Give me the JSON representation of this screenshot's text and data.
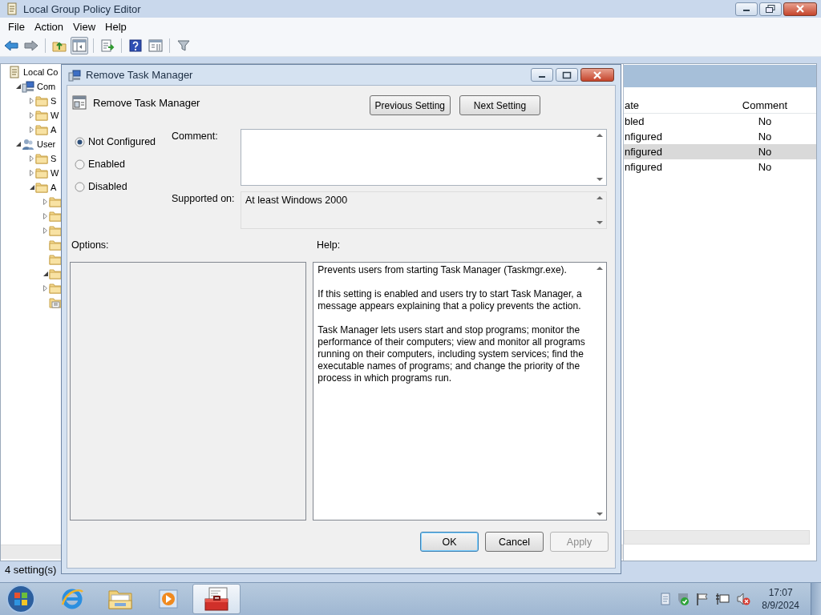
{
  "main_window": {
    "title": "Local Group Policy Editor",
    "menu": [
      "File",
      "Action",
      "View",
      "Help"
    ],
    "toolbar": [
      {
        "kind": "button",
        "pressed": false
      },
      {
        "kind": "button",
        "pressed": false
      },
      {
        "kind": "separator"
      },
      {
        "kind": "button",
        "pressed": false
      },
      {
        "kind": "button",
        "pressed": true
      },
      {
        "kind": "separator"
      },
      {
        "kind": "button",
        "pressed": false
      },
      {
        "kind": "separator"
      },
      {
        "kind": "button",
        "pressed": false
      },
      {
        "kind": "button",
        "pressed": false
      },
      {
        "kind": "separator"
      },
      {
        "kind": "button",
        "pressed": false
      }
    ],
    "tree": [
      {
        "label": "Local Co",
        "kind": "policy",
        "children": [
          {
            "label": "Com",
            "kind": "computer",
            "expanded": true,
            "children": [
              {
                "label": "S",
                "kind": "folder",
                "expanded": false
              },
              {
                "label": "W",
                "kind": "folder",
                "expanded": false
              },
              {
                "label": "A",
                "kind": "folder",
                "expanded": false
              }
            ]
          },
          {
            "label": "User",
            "kind": "user",
            "expanded": true,
            "children": [
              {
                "label": "S",
                "kind": "folder",
                "expanded": false
              },
              {
                "label": "W",
                "kind": "folder",
                "expanded": false
              },
              {
                "label": "A",
                "kind": "folder",
                "expanded": true,
                "children": [
                  {
                    "kind": "folder",
                    "expanded": false
                  },
                  {
                    "kind": "folder",
                    "expanded": false
                  },
                  {
                    "kind": "folder",
                    "expanded": false
                  },
                  {
                    "kind": "folder"
                  },
                  {
                    "kind": "folder"
                  },
                  {
                    "kind": "folder",
                    "expanded": true
                  },
                  {
                    "kind": "folder",
                    "expanded": false
                  },
                  {
                    "kind": "settings"
                  }
                ]
              }
            ]
          }
        ]
      }
    ],
    "list": {
      "columns": [
        "ate",
        "Comment"
      ],
      "rows": [
        {
          "cells": [
            "bled",
            "No"
          ],
          "selected": false
        },
        {
          "cells": [
            "nfigured",
            "No"
          ],
          "selected": false
        },
        {
          "cells": [
            "nfigured",
            "No"
          ],
          "selected": true
        },
        {
          "cells": [
            "nfigured",
            "No"
          ],
          "selected": false
        }
      ]
    },
    "status_bar": "4 setting(s)"
  },
  "dialog": {
    "title": "Remove Task Manager",
    "setting_title": "Remove Task Manager",
    "nav_buttons": [
      "Previous Setting",
      "Next Setting"
    ],
    "radios": [
      {
        "label": "Not Configured",
        "selected": true
      },
      {
        "label": "Enabled",
        "selected": false
      },
      {
        "label": "Disabled",
        "selected": false
      }
    ],
    "comment_label": "Comment:",
    "supported_label": "Supported on:",
    "supported_value": "At least Windows 2000",
    "options_label": "Options:",
    "help_label": "Help:",
    "help_text": [
      "Prevents users from starting Task Manager (Taskmgr.exe).",
      "If this setting is enabled and users try to start Task Manager, a message appears explaining that a policy prevents the action.",
      "Task Manager lets users start and stop programs; monitor the performance of their computers; view and monitor all programs running on their computers, including system services; find the executable names of programs; and change the priority of the process in which programs run."
    ],
    "buttons": [
      {
        "label": "OK",
        "default": true,
        "disabled": false
      },
      {
        "label": "Cancel",
        "default": false,
        "disabled": false
      },
      {
        "label": "Apply",
        "default": false,
        "disabled": true
      }
    ]
  },
  "taskbar": {
    "apps": [
      {
        "active": false
      },
      {
        "active": false
      },
      {
        "active": false
      },
      {
        "active": true
      }
    ],
    "time": "17:07",
    "date": "8/9/2024"
  }
}
